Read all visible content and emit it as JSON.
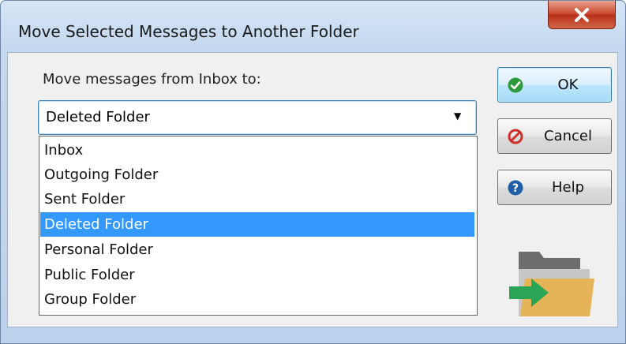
{
  "dialog": {
    "title": "Move Selected Messages to Another Folder",
    "prompt": "Move messages from Inbox to:"
  },
  "select": {
    "value": "Deleted Folder",
    "options": [
      "Inbox",
      "Outgoing Folder",
      "Sent Folder",
      "Deleted Folder",
      "Personal Folder",
      "Public Folder",
      "Group Folder"
    ],
    "highlighted": "Deleted Folder"
  },
  "buttons": {
    "ok": "OK",
    "cancel": "Cancel",
    "help": "Help"
  },
  "icons": {
    "close": "close-icon",
    "ok": "check-icon",
    "cancel": "cancel-icon",
    "help": "help-icon",
    "illustration": "move-to-folder-icon",
    "dropdown": "chevron-down-icon"
  },
  "colors": {
    "selection": "#3399ff",
    "ok_icon": "#2e9a3e",
    "cancel_icon": "#d0302a",
    "help_icon": "#1e5fa8",
    "folder": "#e6b458",
    "arrow": "#2aa455"
  }
}
